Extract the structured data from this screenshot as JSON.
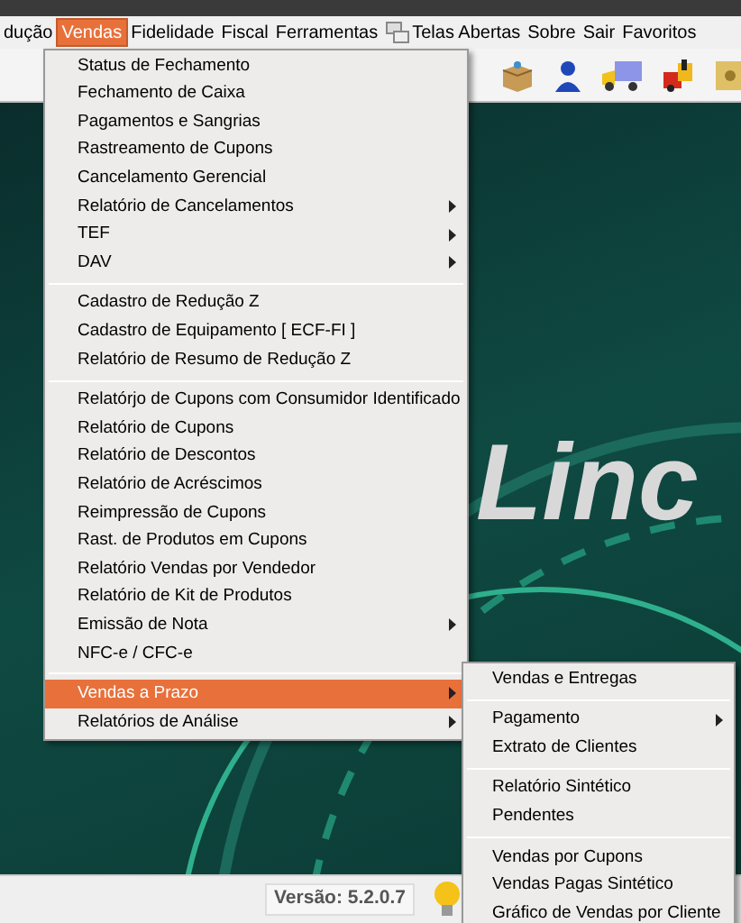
{
  "menu_bar": [
    {
      "label": "dução",
      "selected": false
    },
    {
      "label": "Vendas",
      "selected": true
    },
    {
      "label": "Fidelidade",
      "selected": false
    },
    {
      "label": "Fiscal",
      "selected": false
    },
    {
      "label": "Ferramentas",
      "selected": false
    },
    {
      "label": "Telas Abertas",
      "selected": false,
      "kind": "windows"
    },
    {
      "label": "Sobre",
      "selected": false
    },
    {
      "label": "Sair",
      "selected": false
    },
    {
      "label": "Favoritos",
      "selected": false
    }
  ],
  "menu": {
    "groups": [
      [
        {
          "label": "Status de Fechamento",
          "submenu": false,
          "selected": false
        },
        {
          "label": "Fechamento de Caixa",
          "submenu": false,
          "selected": false
        },
        {
          "label": "Pagamentos e Sangrias",
          "submenu": false,
          "selected": false
        },
        {
          "label": "Rastreamento de Cupons",
          "submenu": false,
          "selected": false
        },
        {
          "label": "Cancelamento Gerencial",
          "submenu": false,
          "selected": false
        },
        {
          "label": "Relatório de Cancelamentos",
          "submenu": true,
          "selected": false
        },
        {
          "label": "TEF",
          "submenu": true,
          "selected": false
        },
        {
          "label": "DAV",
          "submenu": true,
          "selected": false
        }
      ],
      [
        {
          "label": "Cadastro de Redução Z",
          "submenu": false,
          "selected": false
        },
        {
          "label": "Cadastro de Equipamento  [ ECF-FI ]",
          "submenu": false,
          "selected": false
        },
        {
          "label": "Relatório de Resumo de Redução Z",
          "submenu": false,
          "selected": false
        }
      ],
      [
        {
          "label": "Relatórjo de Cupons com  Consumidor Identificado",
          "submenu": false,
          "selected": false
        },
        {
          "label": "Relatório de Cupons",
          "submenu": false,
          "selected": false
        },
        {
          "label": "Relatório de Descontos",
          "submenu": false,
          "selected": false
        },
        {
          "label": "Relatório de Acréscimos",
          "submenu": false,
          "selected": false
        },
        {
          "label": "Reimpressão de Cupons",
          "submenu": false,
          "selected": false
        },
        {
          "label": "Rast. de Produtos em Cupons",
          "submenu": false,
          "selected": false
        },
        {
          "label": "Relatório Vendas por Vendedor",
          "submenu": false,
          "selected": false
        },
        {
          "label": "Relatório de Kit de Produtos",
          "submenu": false,
          "selected": false
        },
        {
          "label": "Emissão de Nota",
          "submenu": true,
          "selected": false
        },
        {
          "label": "NFC-e / CFC-e",
          "submenu": false,
          "selected": false
        }
      ],
      [
        {
          "label": "Vendas a Prazo",
          "submenu": true,
          "selected": true
        },
        {
          "label": "Relatórios de Análise",
          "submenu": true,
          "selected": false
        }
      ]
    ]
  },
  "submenu": {
    "groups": [
      [
        {
          "label": "Vendas e Entregas",
          "submenu": false
        }
      ],
      [
        {
          "label": "Pagamento",
          "submenu": true
        },
        {
          "label": "Extrato de Clientes",
          "submenu": false
        }
      ],
      [
        {
          "label": "Relatório Sintético",
          "submenu": false
        },
        {
          "label": "Pendentes",
          "submenu": false
        }
      ],
      [
        {
          "label": "Vendas por Cupons",
          "submenu": false
        },
        {
          "label": "Vendas Pagas Sintético",
          "submenu": false
        },
        {
          "label": "Gráfico de Vendas por Cliente",
          "submenu": false
        }
      ]
    ]
  },
  "logo_text": "Linc",
  "status_bar": {
    "version": "Versão: 5.2.0.7"
  }
}
